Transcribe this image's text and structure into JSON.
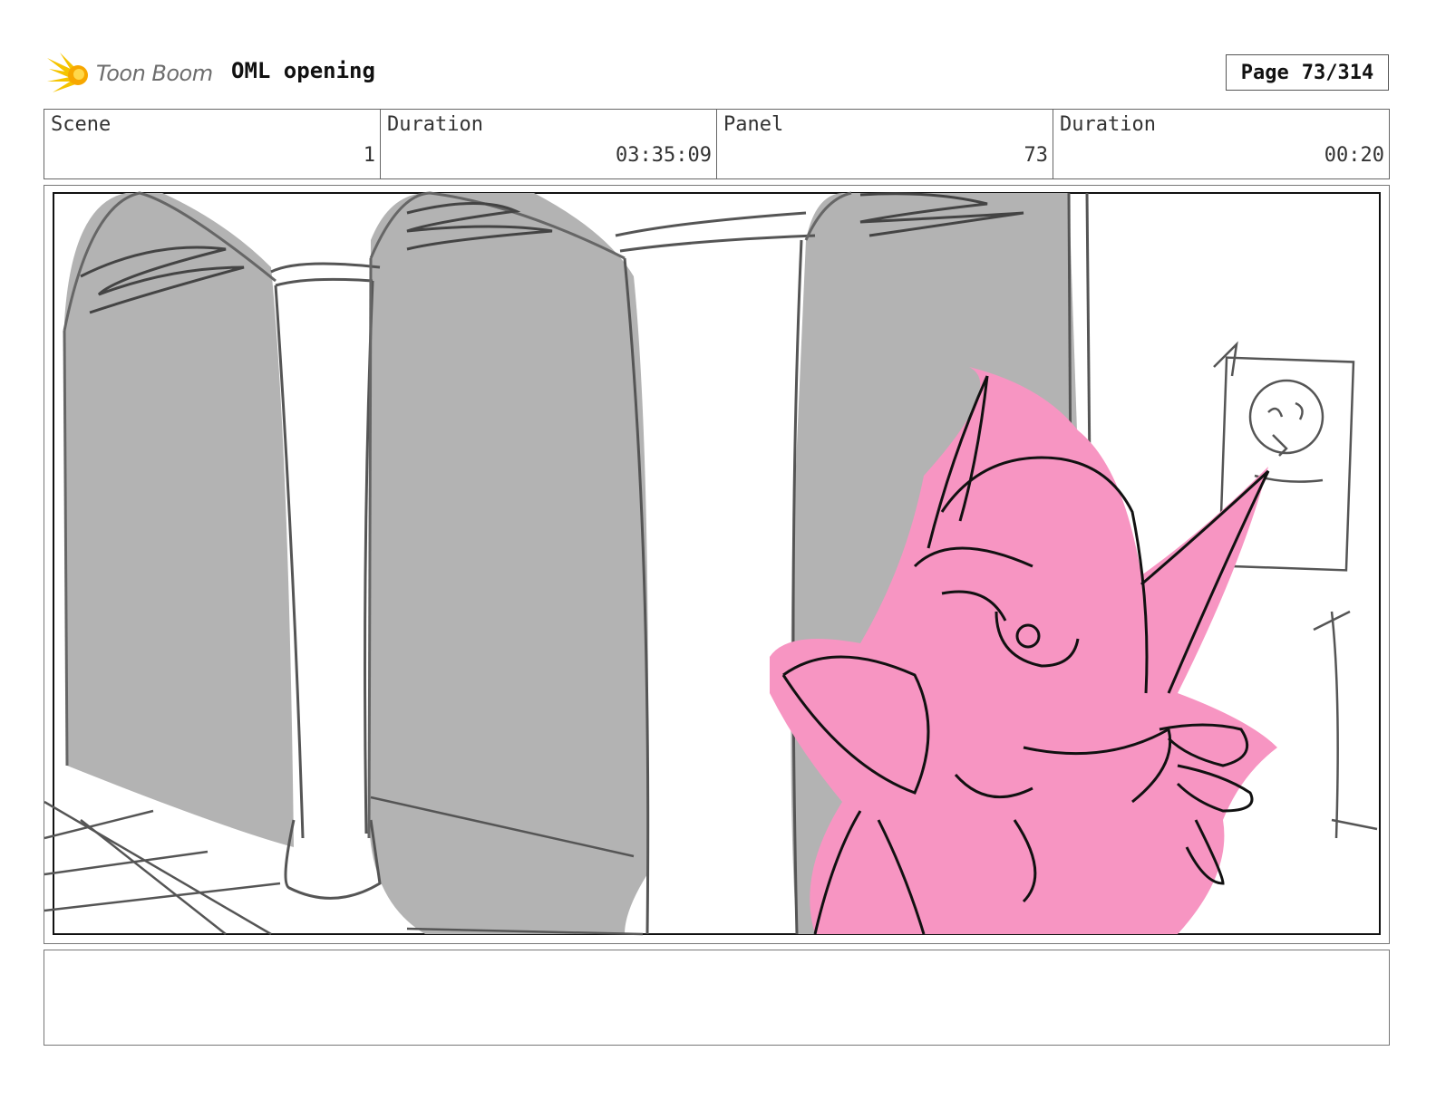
{
  "header": {
    "logo_text": "Toon Boom",
    "project_title": "OML opening",
    "page_label": "Page",
    "page_value": "73/314"
  },
  "info": {
    "scene_label": "Scene",
    "scene_value": "1",
    "duration_label": "Duration",
    "duration_value": "03:35:09",
    "panel_label": "Panel",
    "panel_value": "73",
    "panel_duration_label": "Duration",
    "panel_duration_value": "00:20"
  },
  "colors": {
    "sketch_gray": "#b3b3b3",
    "character_pink": "#f795c2",
    "logo_yellow": "#f5c400"
  }
}
